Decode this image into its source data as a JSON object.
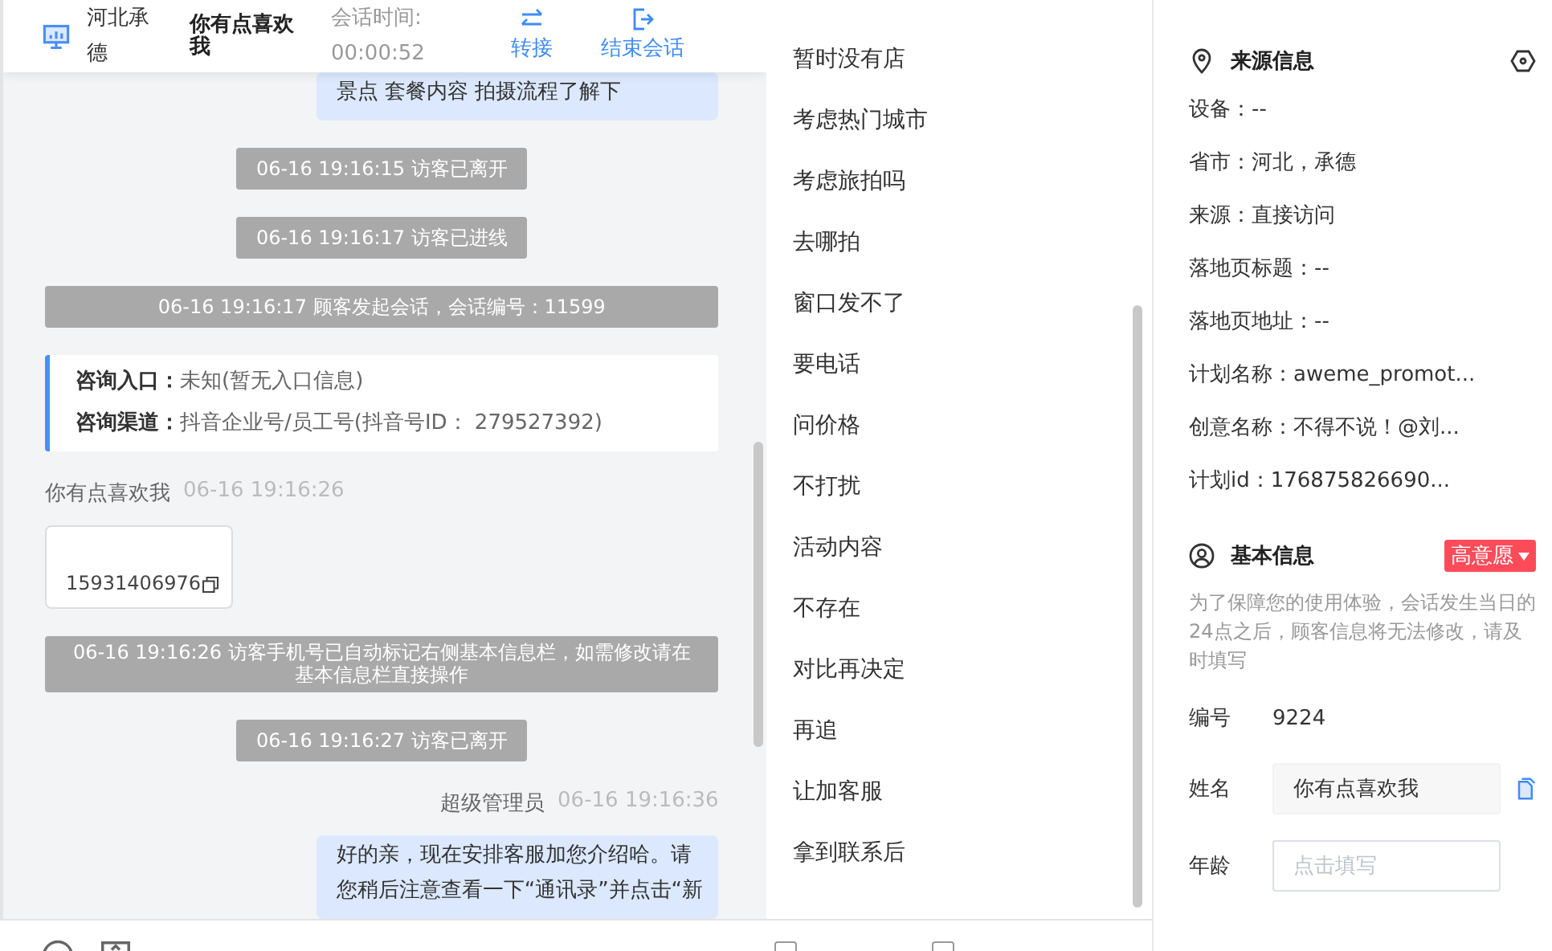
{
  "header": {
    "location": "河北承德",
    "visitor": "你有点喜欢我",
    "session_label": "会话时间:",
    "session_time": "00:00:52",
    "actions": [
      {
        "kind": "transfer",
        "label": "转接"
      },
      {
        "kind": "end",
        "label": "结束会话"
      }
    ]
  },
  "messages": [
    {
      "kind": "agent",
      "text": "景点 套餐内容 拍摄流程了解下"
    },
    {
      "kind": "system",
      "text": "06-16 19:16:15 访客已离开"
    },
    {
      "kind": "system",
      "text": "06-16 19:16:17 访客已进线"
    },
    {
      "kind": "system",
      "text": "06-16 19:16:17 顾客发起会话，会话编号：11599"
    },
    {
      "kind": "info",
      "rows": [
        {
          "label": "咨询入口：",
          "value": "未知(暂无入口信息)"
        },
        {
          "label": "咨询渠道：",
          "value": "抖音企业号/员工号(抖音号ID： 279527392)"
        }
      ]
    },
    {
      "kind": "sender",
      "right_aligned": false,
      "name": "你有点喜欢我",
      "time": "06-16 19:16:26"
    },
    {
      "kind": "phone",
      "text": "15931406976"
    },
    {
      "kind": "system",
      "text": "06-16 19:16:26 访客手机号已自动标记右侧基本信息栏，如需修改请在基本信息栏直接操作"
    },
    {
      "kind": "system",
      "text": "06-16 19:16:27 访客已离开"
    },
    {
      "kind": "sender",
      "right_aligned": true,
      "name": "超级管理员",
      "time": "06-16 19:16:36"
    },
    {
      "kind": "agent",
      "text": "好的亲，现在安排客服加您介绍哈。请您稍后注意查看一下“通讯录”并点击“新"
    }
  ],
  "quick_replies": [
    "暂时没有店",
    "考虑热门城市",
    "考虑旅拍吗",
    "去哪拍",
    "窗口发不了",
    "要电话",
    "问价格",
    "不打扰",
    "活动内容",
    "不存在",
    "对比再决定",
    "再追",
    "让加客服",
    "拿到联系后"
  ],
  "toolbar": {
    "checkboxes": [
      {
        "checked": false
      },
      {
        "checked": false
      }
    ]
  },
  "source_info": {
    "title": "来源信息",
    "rows": [
      "设备：--",
      "省市：河北，承德",
      "来源：直接访问",
      "落地页标题：--",
      "落地页地址：--",
      "计划名称：aweme_promot...",
      "创意名称：不得不说！@刘...",
      "计划id：176875826690..."
    ]
  },
  "basic_info": {
    "title": "基本信息",
    "intent_badge": "高意愿",
    "notice": "为了保障您的使用体验，会话发生当日的24点之后，顾客信息将无法修改，请及时填写",
    "fields": [
      {
        "kind": "text",
        "label": "编号",
        "value": "9224"
      },
      {
        "kind": "input",
        "label": "姓名",
        "value": "你有点喜欢我"
      },
      {
        "kind": "input",
        "label": "年龄",
        "placeholder": "点击填写"
      }
    ]
  }
}
